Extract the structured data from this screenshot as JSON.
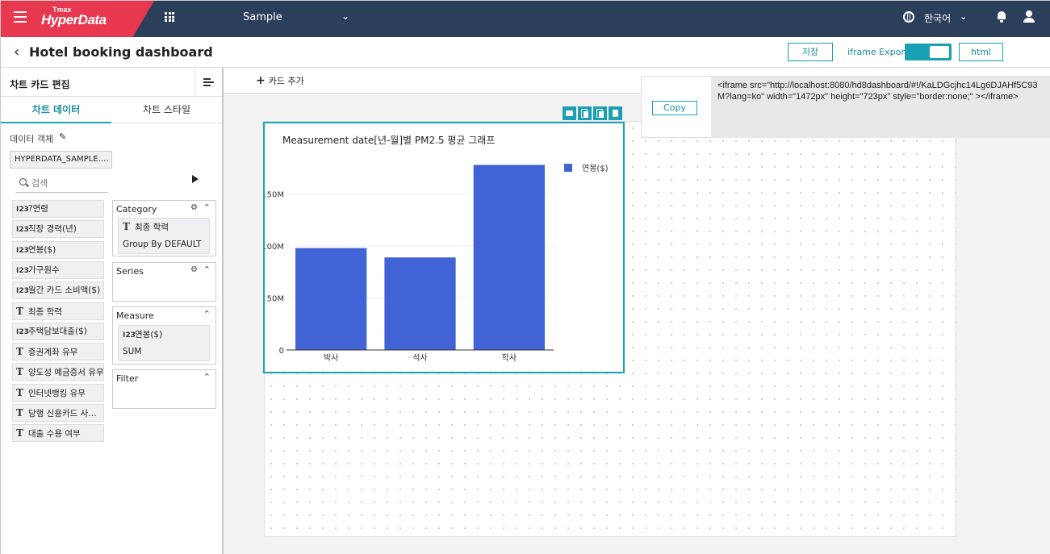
{
  "topbar": {
    "logo_small": "Tmax",
    "logo_large": "HyperData",
    "workspace": "Sample",
    "language": "한국어",
    "icons": [
      "menu-icon",
      "apps-grid-icon",
      "chevron-down-icon",
      "globe-icon",
      "bell-icon",
      "user-icon"
    ]
  },
  "header": {
    "title": "Hotel booking dashboard",
    "save_label": "저장",
    "iframe_export_label": "iframe Export",
    "iframe_export_enabled": true,
    "html_label": "html"
  },
  "left_panel": {
    "title": "차트 카드 편집",
    "tabs": [
      {
        "label": "차트 데이터",
        "active": true
      },
      {
        "label": "차트 스타일",
        "active": false
      }
    ],
    "data_object_label": "데이터 객체",
    "dataset_name": "HYPERDATA_SAMPLE.…",
    "search_placeholder": "검색",
    "fields": [
      {
        "type": "I23",
        "name": "?연령"
      },
      {
        "type": "I23",
        "name": "직장 경력(년)"
      },
      {
        "type": "I23",
        "name": "연봉($)"
      },
      {
        "type": "I23",
        "name": "가구원수"
      },
      {
        "type": "I23",
        "name": "월간 카드 소비액($)"
      },
      {
        "type": "T",
        "name": "최종 학력"
      },
      {
        "type": "I23",
        "name": "주택담보대출($)"
      },
      {
        "type": "T",
        "name": "증권계좌 유무"
      },
      {
        "type": "T",
        "name": "양도성 예금증서 유무"
      },
      {
        "type": "T",
        "name": "인터넷뱅킹 유무"
      },
      {
        "type": "T",
        "name": "당행 신용카드 사…"
      },
      {
        "type": "T",
        "name": "대출 수용 여부"
      }
    ],
    "category": {
      "title": "Category",
      "field_type": "T",
      "field": "최종 학력",
      "agg": "Group By DEFAULT"
    },
    "series": {
      "title": "Series"
    },
    "measure": {
      "title": "Measure",
      "field_type": "I23",
      "field": "연봉($)",
      "agg": "SUM"
    },
    "filter": {
      "title": "Filter"
    }
  },
  "canvas": {
    "add_card_label": "카드 추가",
    "card_tools": [
      "camera-icon",
      "duplicate-icon",
      "copy-icon",
      "trash-icon"
    ]
  },
  "popup": {
    "copy_label": "Copy",
    "code": "<iframe src=\"http://localhost:8080/hd8dashboard/#!/KaLDGcjhc14Lg6DJAHf5C93M?lang=ko\" width=\"1472px\" height=\"723px\" style=\"border:none;\" ></iframe>"
  },
  "chart_data": {
    "type": "bar",
    "title": "Measurement date[년-월]별 PM2.5 평균 그래프",
    "categories": [
      "박사",
      "석사",
      "학사"
    ],
    "series": [
      {
        "name": "연봉($)",
        "values": [
          98,
          89,
          178
        ],
        "color": "#4263d6"
      }
    ],
    "unit": "M",
    "y_ticks": [
      0,
      50,
      100,
      150
    ],
    "y_tick_labels": [
      "0",
      "50M",
      "100M",
      "150M"
    ],
    "ylim": [
      0,
      190
    ],
    "legend": "top-right",
    "grid": true
  }
}
